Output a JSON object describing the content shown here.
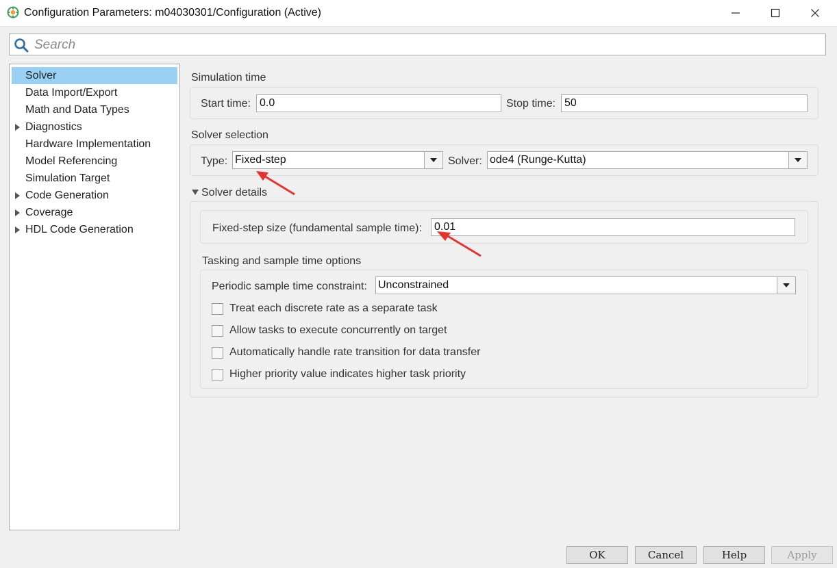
{
  "window": {
    "title": "Configuration Parameters: m04030301/Configuration (Active)"
  },
  "search": {
    "placeholder": "Search"
  },
  "tree": {
    "items": [
      {
        "label": "Solver",
        "selected": true,
        "expandable": false
      },
      {
        "label": "Data Import/Export",
        "selected": false,
        "expandable": false
      },
      {
        "label": "Math and Data Types",
        "selected": false,
        "expandable": false
      },
      {
        "label": "Diagnostics",
        "selected": false,
        "expandable": true
      },
      {
        "label": "Hardware Implementation",
        "selected": false,
        "expandable": false
      },
      {
        "label": "Model Referencing",
        "selected": false,
        "expandable": false
      },
      {
        "label": "Simulation Target",
        "selected": false,
        "expandable": false
      },
      {
        "label": "Code Generation",
        "selected": false,
        "expandable": true
      },
      {
        "label": "Coverage",
        "selected": false,
        "expandable": true
      },
      {
        "label": "HDL Code Generation",
        "selected": false,
        "expandable": true
      }
    ]
  },
  "simulation_time": {
    "title": "Simulation time",
    "start_label": "Start time:",
    "start_value": "0.0",
    "stop_label": "Stop time:",
    "stop_value": "50"
  },
  "solver_selection": {
    "title": "Solver selection",
    "type_label": "Type:",
    "type_value": "Fixed-step",
    "solver_label": "Solver:",
    "solver_value": "ode4 (Runge-Kutta)"
  },
  "solver_details": {
    "title": "Solver details",
    "step_size_label": "Fixed-step size (fundamental sample time):",
    "step_size_value": "0.01",
    "tasking_title": "Tasking and sample time options",
    "periodic_label": "Periodic sample time constraint:",
    "periodic_value": "Unconstrained",
    "checkboxes": [
      {
        "label": "Treat each discrete rate as a separate task",
        "checked": false
      },
      {
        "label": "Allow tasks to execute concurrently on target",
        "checked": false
      },
      {
        "label": "Automatically handle rate transition for data transfer",
        "checked": false
      },
      {
        "label": "Higher priority value indicates higher task priority",
        "checked": false
      }
    ]
  },
  "buttons": {
    "ok": "OK",
    "cancel": "Cancel",
    "help": "Help",
    "apply": "Apply"
  },
  "colors": {
    "selection": "#99d0f3",
    "annotation_arrow": "#e8332d"
  }
}
